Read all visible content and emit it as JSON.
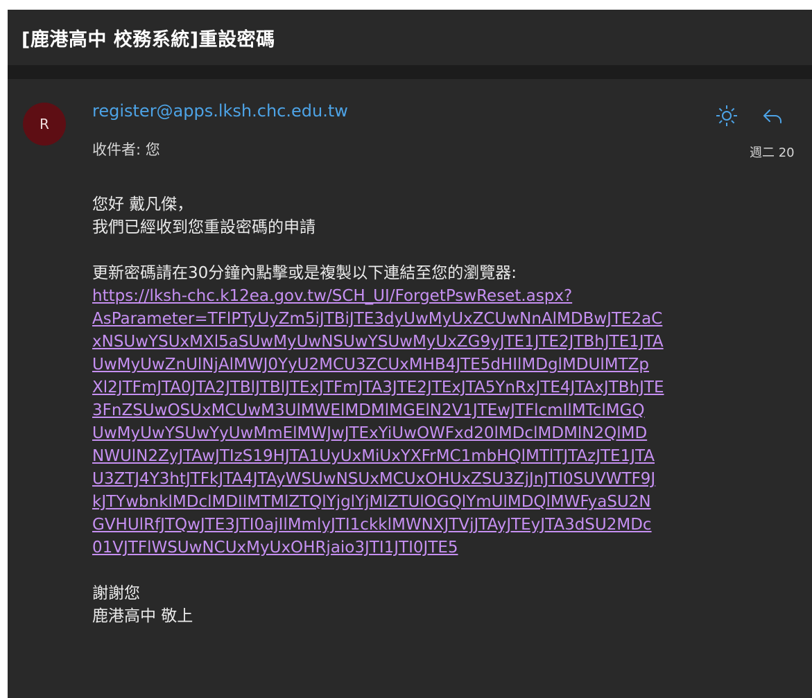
{
  "email": {
    "subject": "[鹿港高中 校務系統]重設密碼",
    "sender_initial": "R",
    "sender": "register@apps.lksh.chc.edu.tw",
    "recipient": "收件者: 您",
    "date": "週二 20",
    "icons": [
      "sun-icon",
      "reply-icon"
    ],
    "body": {
      "greeting": "您好 戴凡傑，",
      "line_received": "我們已經收到您重設密碼的申請",
      "instruction": "更新密碼請在30分鐘內點擊或是複製以下連結至您的瀏覽器:",
      "link_lines": [
        "https://lksh-chc.k12ea.gov.tw/SCH_UI/ForgetPswReset.aspx?",
        "AsParameter=TFlPTyUyZm5iJTBiJTE3dyUwMyUxZCUwNnAlMDBwJTE2aC",
        "xNSUwYSUxMXl5aSUwMyUwNSUwYSUwMyUxZG9yJTE1JTE2JTBhJTE1JTA",
        "UwMyUwZnUlNjAlMWJ0YyU2MCU3ZCUxMHB4JTE5dHIlMDglMDUlMTZp",
        "Xl2JTFmJTA0JTA2JTBlJTBlJTExJTFmJTA3JTE2JTExJTA5YnRxJTE4JTAxJTBhJTE",
        "3FnZSUwOSUxMCUwM3UlMWElMDMlMGElN2V1JTEwJTFlcmIlMTclMGQ",
        "UwMyUwYSUwYyUwMmElMWJwJTExYiUwOWFxd20lMDclMDMlN2QlMD",
        "NWUlN2ZyJTAwJTIzS19HJTA1UyUxMiUxYXFrMC1mbHQlMTlTJTAzJTE1JTA",
        "U3ZTJ4Y3htJTFkJTA4JTAyWSUwNSUxMCUxOHUxZSU3ZjJnJTI0SUVWTF9J",
        "kJTYwbnklMDclMDIlMTMlZTQlYjglYjMlZTUlOGQlYmUlMDQlMWFyaSU2N",
        "GVHUlRfJTQwJTE3JTI0ajIlMmlyJTI1ckklMWNXJTVjJTAyJTEyJTA3dSU2MDc",
        "01VJTFlWSUwNCUxMyUxOHRjaio3JTI1JTI0JTE5"
      ],
      "thanks": "謝謝您",
      "signature": "鹿港高中 敬上"
    }
  },
  "colors": {
    "background": "#292929",
    "header_separator": "#1c1c1c",
    "sender_link": "#4da3e6",
    "body_link": "#c690f2",
    "avatar": "#5e0e14"
  }
}
